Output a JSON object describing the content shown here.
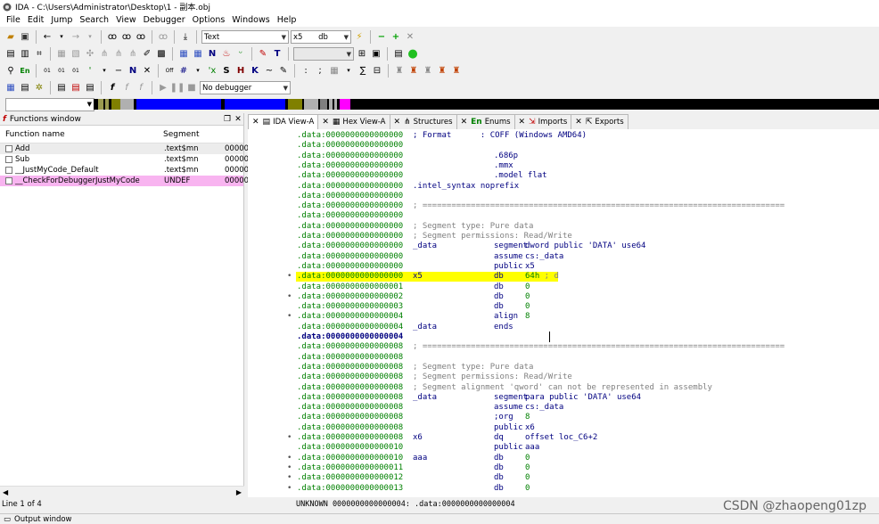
{
  "window": {
    "title": "IDA - C:\\Users\\Administrator\\Desktop\\1 - 副本.obj"
  },
  "menu": [
    "File",
    "Edit",
    "Jump",
    "Search",
    "View",
    "Debugger",
    "Options",
    "Windows",
    "Help"
  ],
  "toolbar": {
    "text_combo": "Text",
    "name_combo": "x5",
    "type_combo": "db",
    "debugger_combo": "No debugger"
  },
  "functions_window": {
    "title": "Functions window",
    "columns": [
      "Function name",
      "Segment",
      ""
    ],
    "rows": [
      {
        "name": "Add",
        "segment": ".text$mn",
        "start": "00000"
      },
      {
        "name": "Sub",
        "segment": ".text$mn",
        "start": "00000"
      },
      {
        "name": "__JustMyCode_Default",
        "segment": ".text$mn",
        "start": "00000"
      },
      {
        "name": "__CheckForDebuggerJustMyCode",
        "segment": "UNDEF",
        "start": "00000"
      }
    ],
    "line_status": "Line 1 of 4"
  },
  "tabs": [
    {
      "label": "IDA View-A",
      "icon": "disasm-icon",
      "active": true
    },
    {
      "label": "Hex View-A",
      "icon": "hex-icon"
    },
    {
      "label": "Structures",
      "icon": "struct-icon"
    },
    {
      "label": "Enums",
      "icon": "en-icon"
    },
    {
      "label": "Imports",
      "icon": "imports-icon"
    },
    {
      "label": "Exports",
      "icon": "exports-icon"
    }
  ],
  "disasm": [
    {
      "dot": "",
      "addr": ".data:0000000000000000",
      "kind": "cmt",
      "text": "; Format      : COFF (Windows AMD64)"
    },
    {
      "dot": "",
      "addr": ".data:0000000000000000",
      "kind": "blank"
    },
    {
      "dot": "",
      "addr": ".data:0000000000000000",
      "kind": "dir",
      "text": ".686p"
    },
    {
      "dot": "",
      "addr": ".data:0000000000000000",
      "kind": "dir",
      "text": ".mmx"
    },
    {
      "dot": "",
      "addr": ".data:0000000000000000",
      "kind": "dir",
      "text": ".model flat"
    },
    {
      "dot": "",
      "addr": ".data:0000000000000000",
      "kind": "label",
      "text": ".intel_syntax noprefix"
    },
    {
      "dot": "",
      "addr": ".data:0000000000000000",
      "kind": "blank"
    },
    {
      "dot": "",
      "addr": ".data:0000000000000000",
      "kind": "cmt",
      "text": "; ==========================================================================="
    },
    {
      "dot": "",
      "addr": ".data:0000000000000000",
      "kind": "blank"
    },
    {
      "dot": "",
      "addr": ".data:0000000000000000",
      "kind": "cmt",
      "text": "; Segment type: Pure data"
    },
    {
      "dot": "",
      "addr": ".data:0000000000000000",
      "kind": "cmt",
      "text": "; Segment permissions: Read/Write"
    },
    {
      "dot": "",
      "addr": ".data:0000000000000000",
      "kind": "code",
      "label": "_data",
      "mn": "segment",
      "ops": "dword public 'DATA' use64"
    },
    {
      "dot": "",
      "addr": ".data:0000000000000000",
      "kind": "code",
      "label": "",
      "mn": "assume",
      "ops": "cs:_data"
    },
    {
      "dot": "",
      "addr": ".data:0000000000000000",
      "kind": "code",
      "label": "",
      "mn": "public",
      "ops": "x5"
    },
    {
      "dot": "•",
      "addr": ".data:0000000000000000",
      "kind": "code",
      "label": "x5",
      "mn": "db",
      "ops": "64h",
      "inl": " ; d",
      "highlight": true
    },
    {
      "dot": "",
      "addr": ".data:0000000000000001",
      "kind": "code",
      "label": "",
      "mn": "db",
      "ops": "0"
    },
    {
      "dot": "•",
      "addr": ".data:0000000000000002",
      "kind": "code",
      "label": "",
      "mn": "db",
      "ops": "0"
    },
    {
      "dot": "",
      "addr": ".data:0000000000000003",
      "kind": "code",
      "label": "",
      "mn": "db",
      "ops": "0"
    },
    {
      "dot": "•",
      "addr": ".data:0000000000000004",
      "kind": "code",
      "label": "",
      "mn": "align",
      "ops": "8"
    },
    {
      "dot": "",
      "addr": ".data:0000000000000004",
      "kind": "code",
      "label": "_data",
      "mn": "ends",
      "ops": ""
    },
    {
      "dot": "",
      "addr": ".data:0000000000000004",
      "kind": "blank",
      "bold": true
    },
    {
      "dot": "",
      "addr": ".data:0000000000000008",
      "kind": "cmt",
      "text": "; ==========================================================================="
    },
    {
      "dot": "",
      "addr": ".data:0000000000000008",
      "kind": "blank"
    },
    {
      "dot": "",
      "addr": ".data:0000000000000008",
      "kind": "cmt",
      "text": "; Segment type: Pure data"
    },
    {
      "dot": "",
      "addr": ".data:0000000000000008",
      "kind": "cmt",
      "text": "; Segment permissions: Read/Write"
    },
    {
      "dot": "",
      "addr": ".data:0000000000000008",
      "kind": "cmt",
      "text": "; Segment alignment 'qword' can not be represented in assembly"
    },
    {
      "dot": "",
      "addr": ".data:0000000000000008",
      "kind": "code",
      "label": "_data",
      "mn": "segment",
      "ops": "para public 'DATA' use64"
    },
    {
      "dot": "",
      "addr": ".data:0000000000000008",
      "kind": "code",
      "label": "",
      "mn": "assume",
      "ops": "cs:_data"
    },
    {
      "dot": "",
      "addr": ".data:0000000000000008",
      "kind": "code",
      "label": "",
      "mn": ";org",
      "ops": "8"
    },
    {
      "dot": "",
      "addr": ".data:0000000000000008",
      "kind": "code",
      "label": "",
      "mn": "public",
      "ops": "x6"
    },
    {
      "dot": "•",
      "addr": ".data:0000000000000008",
      "kind": "code",
      "label": "x6",
      "mn": "dq",
      "ops": "offset loc_C6+2"
    },
    {
      "dot": "",
      "addr": ".data:0000000000000010",
      "kind": "code",
      "label": "",
      "mn": "public",
      "ops": "aaa"
    },
    {
      "dot": "•",
      "addr": ".data:0000000000000010",
      "kind": "code",
      "label": "aaa",
      "mn": "db",
      "ops": "0"
    },
    {
      "dot": "•",
      "addr": ".data:0000000000000011",
      "kind": "code",
      "label": "",
      "mn": "db",
      "ops": "0"
    },
    {
      "dot": "•",
      "addr": ".data:0000000000000012",
      "kind": "code",
      "label": "",
      "mn": "db",
      "ops": "0"
    },
    {
      "dot": "•",
      "addr": ".data:0000000000000013",
      "kind": "code",
      "label": "",
      "mn": "db",
      "ops": "0"
    }
  ],
  "status_right": "UNKNOWN 0000000000000004: .data:0000000000000004",
  "output_window": {
    "title": "Output window"
  },
  "watermark": "CSDN @zhaopeng01zp",
  "colors": {
    "highlight": "#ffff00",
    "pink_row": "#f8b4f0",
    "navy_text": "#000080",
    "green_addr": "#008000"
  }
}
